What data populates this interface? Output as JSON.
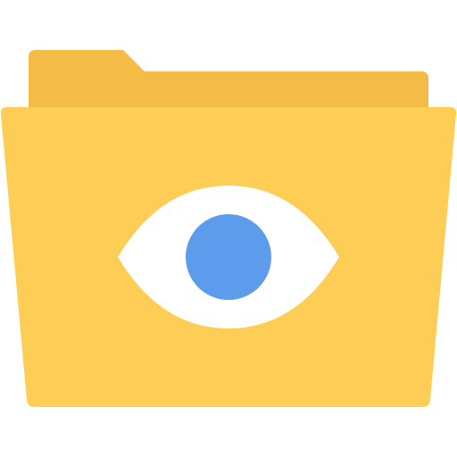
{
  "icon": {
    "name": "folder-eye-icon",
    "colors": {
      "folder_tab": "#F4BB47",
      "folder_body": "#FECD55",
      "eye_white": "#FFFFFF",
      "pupil": "#5D9CEC"
    }
  }
}
